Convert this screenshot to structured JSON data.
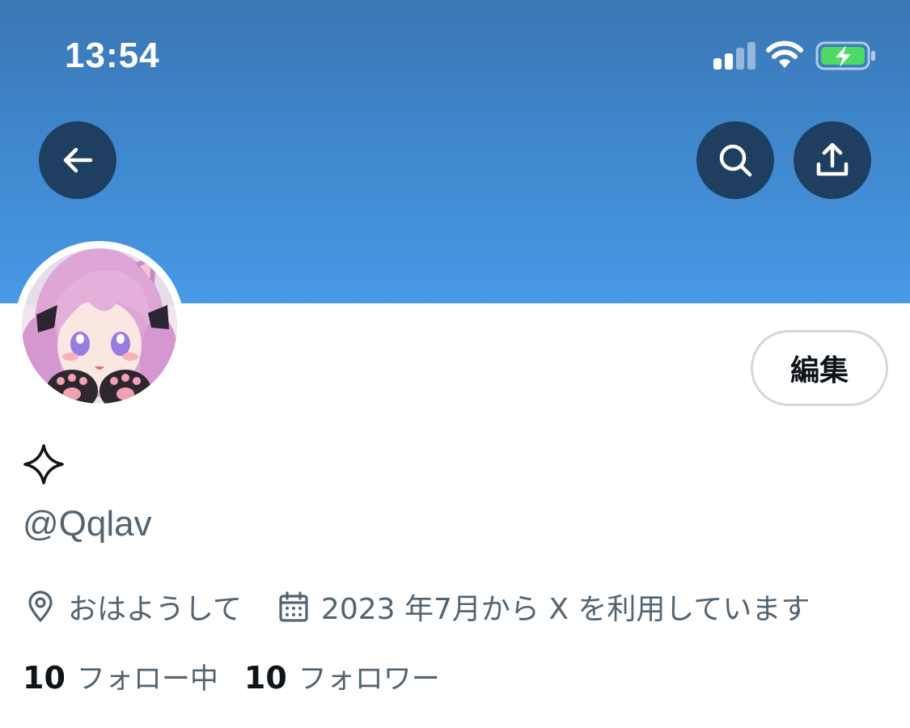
{
  "status_bar": {
    "time": "13:54",
    "icons": [
      "cellular-signal-icon",
      "wifi-icon",
      "battery-charging-icon"
    ],
    "battery_color": "#4cd964"
  },
  "header": {
    "banner_color": "#4899e6",
    "buttons": [
      "back-arrow-icon",
      "search-icon",
      "share-icon"
    ],
    "button_color": "#1e3f5f"
  },
  "profile": {
    "avatar": "anime-girl-avatar",
    "edit_label": "編集",
    "display_name_icon": "four-point-sparkle-icon",
    "handle": "@Qqlav",
    "location": "おはようして",
    "joined": "2023 年7月から X を利用しています",
    "following_count": "10",
    "following_label": "フォロー中",
    "followers_count": "10",
    "followers_label": "フォロワー"
  }
}
